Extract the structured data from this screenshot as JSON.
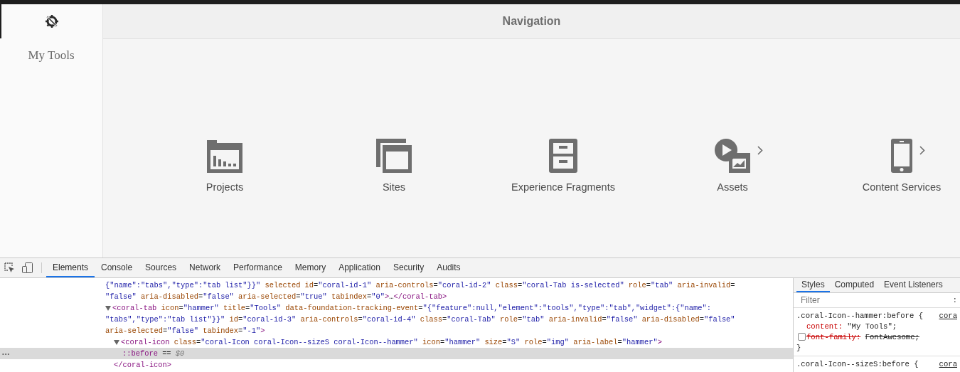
{
  "sidebar": {
    "items": [
      {
        "label": "My Tools",
        "selected": true
      }
    ]
  },
  "header": {
    "title": "Navigation"
  },
  "tiles": [
    {
      "kind": "projects",
      "label": "Projects",
      "has_children": false
    },
    {
      "kind": "sites",
      "label": "Sites",
      "has_children": false
    },
    {
      "kind": "fragments",
      "label": "Experience Fragments",
      "has_children": false
    },
    {
      "kind": "assets",
      "label": "Assets",
      "has_children": true
    },
    {
      "kind": "phone",
      "label": "Content Services",
      "has_children": true
    }
  ],
  "devtools": {
    "tabs": [
      {
        "label": "Elements",
        "selected": true
      },
      {
        "label": "Console",
        "selected": false
      },
      {
        "label": "Sources",
        "selected": false
      },
      {
        "label": "Network",
        "selected": false
      },
      {
        "label": "Performance",
        "selected": false
      },
      {
        "label": "Memory",
        "selected": false
      },
      {
        "label": "Application",
        "selected": false
      },
      {
        "label": "Security",
        "selected": false
      },
      {
        "label": "Audits",
        "selected": false
      }
    ],
    "dom": [
      {
        "lines": [
          [
            {
              "kind": "val",
              "text": "{\"name\":\"tabs\",\"type\":\"tab list\"}}\""
            },
            {
              "kind": "attr",
              "text": " selected id"
            },
            {
              "kind": "text",
              "text": "="
            },
            {
              "kind": "val",
              "text": "\"coral-id-1\""
            },
            {
              "kind": "attr",
              "text": " aria-controls"
            },
            {
              "kind": "text",
              "text": "="
            },
            {
              "kind": "val",
              "text": "\"coral-id-2\""
            },
            {
              "kind": "attr",
              "text": " class"
            },
            {
              "kind": "text",
              "text": "="
            },
            {
              "kind": "val",
              "text": "\"coral-Tab is-selected\""
            },
            {
              "kind": "attr",
              "text": " role"
            },
            {
              "kind": "text",
              "text": "="
            },
            {
              "kind": "val",
              "text": "\"tab\""
            },
            {
              "kind": "attr",
              "text": " aria-invalid"
            },
            {
              "kind": "text",
              "text": "="
            }
          ],
          [
            {
              "kind": "val",
              "text": "\"false\""
            },
            {
              "kind": "attr",
              "text": " aria-disabled"
            },
            {
              "kind": "text",
              "text": "="
            },
            {
              "kind": "val",
              "text": "\"false\""
            },
            {
              "kind": "attr",
              "text": " aria-selected"
            },
            {
              "kind": "text",
              "text": "="
            },
            {
              "kind": "val",
              "text": "\"true\""
            },
            {
              "kind": "attr",
              "text": " tabindex"
            },
            {
              "kind": "text",
              "text": "="
            },
            {
              "kind": "val",
              "text": "\"0\""
            },
            {
              "kind": "tag",
              "text": ">"
            },
            {
              "kind": "text",
              "text": "…"
            },
            {
              "kind": "tag",
              "text": "</coral-tab>"
            }
          ]
        ]
      },
      {
        "expanded": true,
        "lines": [
          [
            {
              "kind": "tag",
              "text": "<coral-tab"
            },
            {
              "kind": "attr",
              "text": " icon"
            },
            {
              "kind": "text",
              "text": "="
            },
            {
              "kind": "val",
              "text": "\"hammer\""
            },
            {
              "kind": "attr",
              "text": " title"
            },
            {
              "kind": "text",
              "text": "="
            },
            {
              "kind": "val",
              "text": "\"Tools\""
            },
            {
              "kind": "attr",
              "text": " data-foundation-tracking-event"
            },
            {
              "kind": "text",
              "text": "="
            },
            {
              "kind": "val",
              "text": "\"{\"feature\":null,\"element\":\"tools\",\"type\":\"tab\",\"widget\":{\"name\":"
            }
          ],
          [
            {
              "kind": "val",
              "text": "\"tabs\",\"type\":\"tab list\"}}\""
            },
            {
              "kind": "attr",
              "text": " id"
            },
            {
              "kind": "text",
              "text": "="
            },
            {
              "kind": "val",
              "text": "\"coral-id-3\""
            },
            {
              "kind": "attr",
              "text": " aria-controls"
            },
            {
              "kind": "text",
              "text": "="
            },
            {
              "kind": "val",
              "text": "\"coral-id-4\""
            },
            {
              "kind": "attr",
              "text": " class"
            },
            {
              "kind": "text",
              "text": "="
            },
            {
              "kind": "val",
              "text": "\"coral-Tab\""
            },
            {
              "kind": "attr",
              "text": " role"
            },
            {
              "kind": "text",
              "text": "="
            },
            {
              "kind": "val",
              "text": "\"tab\""
            },
            {
              "kind": "attr",
              "text": " aria-invalid"
            },
            {
              "kind": "text",
              "text": "="
            },
            {
              "kind": "val",
              "text": "\"false\""
            },
            {
              "kind": "attr",
              "text": " aria-disabled"
            },
            {
              "kind": "text",
              "text": "="
            },
            {
              "kind": "val",
              "text": "\"false\""
            }
          ],
          [
            {
              "kind": "attr",
              "text": "aria-selected"
            },
            {
              "kind": "text",
              "text": "="
            },
            {
              "kind": "val",
              "text": "\"false\""
            },
            {
              "kind": "attr",
              "text": " tabindex"
            },
            {
              "kind": "text",
              "text": "="
            },
            {
              "kind": "val",
              "text": "\"-1\""
            },
            {
              "kind": "tag",
              "text": ">"
            }
          ]
        ],
        "children": [
          {
            "expanded": true,
            "lines": [
              [
                {
                  "kind": "tag",
                  "text": "<coral-icon"
                },
                {
                  "kind": "attr",
                  "text": " class"
                },
                {
                  "kind": "text",
                  "text": "="
                },
                {
                  "kind": "val",
                  "text": "\"coral-Icon coral-Icon--sizeS coral-Icon--hammer\""
                },
                {
                  "kind": "attr",
                  "text": " icon"
                },
                {
                  "kind": "text",
                  "text": "="
                },
                {
                  "kind": "val",
                  "text": "\"hammer\""
                },
                {
                  "kind": "attr",
                  "text": " size"
                },
                {
                  "kind": "text",
                  "text": "="
                },
                {
                  "kind": "val",
                  "text": "\"S\""
                },
                {
                  "kind": "attr",
                  "text": " role"
                },
                {
                  "kind": "text",
                  "text": "="
                },
                {
                  "kind": "val",
                  "text": "\"img\""
                },
                {
                  "kind": "attr",
                  "text": " aria-label"
                },
                {
                  "kind": "text",
                  "text": "="
                },
                {
                  "kind": "val",
                  "text": "\"hammer\""
                },
                {
                  "kind": "tag",
                  "text": ">"
                }
              ]
            ],
            "children": [
              {
                "selected": true,
                "lines": [
                  [
                    {
                      "kind": "tag",
                      "text": "::before"
                    },
                    {
                      "kind": "text",
                      "text": " == "
                    },
                    {
                      "kind": "dim",
                      "text": "$0"
                    }
                  ]
                ]
              }
            ]
          },
          {
            "lines": [
              [
                {
                  "kind": "tag",
                  "text": "</coral-icon>"
                }
              ]
            ]
          }
        ]
      }
    ],
    "selected_row_marker": "•••",
    "styles": {
      "tabs": [
        {
          "label": "Styles",
          "selected": true
        },
        {
          "label": "Computed",
          "selected": false
        },
        {
          "label": "Event Listeners",
          "selected": false
        }
      ],
      "filter": {
        "placeholder": "Filter"
      },
      "filter_toggle": ":",
      "rules": [
        {
          "selector": ".coral-Icon--hammer:before {",
          "source": "cora",
          "declarations": [
            {
              "property": "content:",
              "value": "\"My Tools\";",
              "enabled": true
            },
            {
              "property": "font-family:",
              "value": "FontAwesome;",
              "enabled": false
            }
          ],
          "close": "}"
        },
        {
          "selector": ".coral-Icon--sizeS:before {",
          "source": "cora"
        }
      ]
    }
  }
}
